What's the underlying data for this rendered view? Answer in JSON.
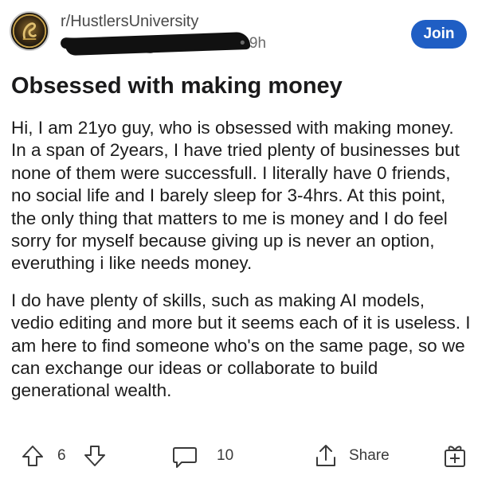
{
  "header": {
    "community": "r/HustlersUniversity",
    "age": "• 9h",
    "join_label": "Join"
  },
  "post": {
    "title": "Obsessed with making money",
    "paragraphs": [
      "Hi, I am 21yo guy, who is obsessed with making money. In a span of 2years, I have tried plenty of businesses but none of them were successfull. I literally have 0 friends, no social life and I barely sleep for 3-4hrs. At this point, the only thing that matters to me is money and I do feel sorry for myself because giving up is never an option, everuthing i like needs money.",
      "I do have plenty of skills, such as making AI models, vedio editing and more but it seems each of it is useless. I am here to find someone who's on the same page, so we can exchange our  ideas or collaborate to build generational wealth."
    ]
  },
  "actions": {
    "votes": "6",
    "comments": "10",
    "share_label": "Share",
    "icons": [
      "upvote-icon",
      "downvote-icon",
      "comment-icon",
      "share-icon",
      "award-icon"
    ]
  },
  "colors": {
    "join_button": "#1f5ec4",
    "text": "#1a1a1b",
    "meta": "#6a6a6a"
  }
}
